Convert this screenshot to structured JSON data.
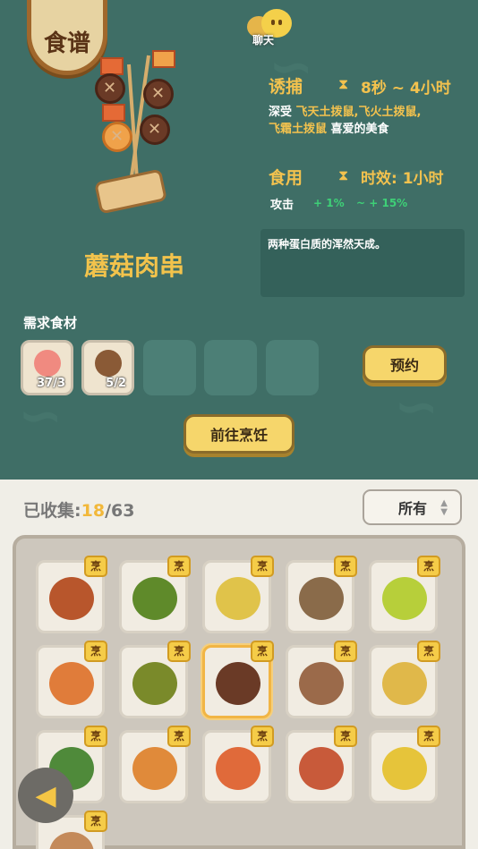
{
  "header": {
    "badge": "食谱",
    "chat_label": "聊天"
  },
  "recipe": {
    "name": "蘑菇肉串",
    "description": "两种蛋白质的浑然天成。"
  },
  "lure": {
    "title": "诱捕",
    "timer": "8秒 ~ 4小时",
    "line_prefix": "深受",
    "line_targets_1": "飞天土拨鼠,飞火土拨鼠,",
    "line_targets_2": "飞霜土拨鼠",
    "line_suffix": "喜爱的美食"
  },
  "eat": {
    "title": "食用",
    "timer": "时效: 1小时",
    "stat_label": "攻击",
    "buff_1": "+ 1%",
    "buff_2": "~ + 15%"
  },
  "ingredients": {
    "title": "需求食材",
    "items": [
      {
        "count": "37/3",
        "icon": "meat-leg-icon"
      },
      {
        "count": "5/2",
        "icon": "mushroom-icon"
      }
    ]
  },
  "buttons": {
    "reserve": "预约",
    "go_cook": "前往烹饪"
  },
  "collection": {
    "label": "已收集:",
    "collected": "18",
    "total": "/63",
    "filter": "所有"
  },
  "cells": [
    {
      "tag": "烹",
      "icon": "skewer-icon",
      "color": "#b8562c"
    },
    {
      "tag": "烹",
      "icon": "veg-skewer-icon",
      "color": "#5f8a2a"
    },
    {
      "tag": "烹",
      "icon": "bowl-icon",
      "color": "#e0c34a"
    },
    {
      "tag": "烹",
      "icon": "fish-skewer-icon",
      "color": "#8a6b4a"
    },
    {
      "tag": "烹",
      "icon": "fruit-icon",
      "color": "#b7cf3a"
    },
    {
      "tag": "烹",
      "icon": "stew-icon",
      "color": "#e07c3a"
    },
    {
      "tag": "烹",
      "icon": "salad-icon",
      "color": "#7a8a2a"
    },
    {
      "tag": "烹",
      "icon": "mushroom-skewer-icon",
      "color": "#6a3a26"
    },
    {
      "tag": "烹",
      "icon": "seafood-icon",
      "color": "#9b6a4a"
    },
    {
      "tag": "烹",
      "icon": "bowl-icon",
      "color": "#e0b84a"
    },
    {
      "tag": "烹",
      "icon": "vegetable-icon",
      "color": "#4f8a3a"
    },
    {
      "tag": "烹",
      "icon": "soup-icon",
      "color": "#e08a3a"
    },
    {
      "tag": "烹",
      "icon": "soup-icon",
      "color": "#e06a3a"
    },
    {
      "tag": "烹",
      "icon": "roast-icon",
      "color": "#c85a3a"
    },
    {
      "tag": "烹",
      "icon": "leaf-plate-icon",
      "color": "#e6c43a"
    },
    {
      "tag": "烹",
      "icon": "dish-icon",
      "color": "#c48a5a"
    }
  ]
}
